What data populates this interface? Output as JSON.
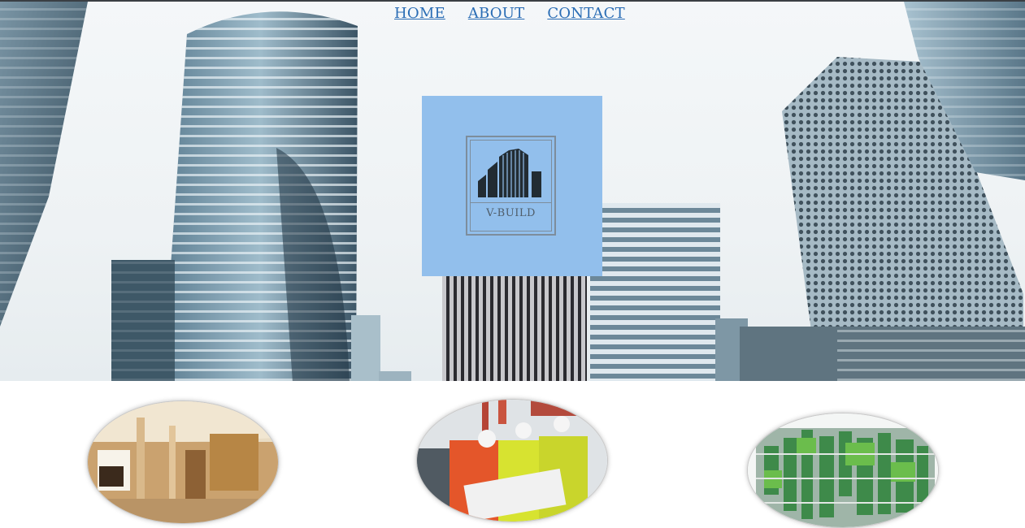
{
  "nav": {
    "links": [
      {
        "label": "HOME"
      },
      {
        "label": "ABOUT"
      },
      {
        "label": "CONTACT"
      }
    ]
  },
  "hero": {
    "image": "city-skyscrapers-photo"
  },
  "logo": {
    "text": "V-BUILD",
    "icon": "building-icon",
    "background_color": "#92bfec"
  },
  "services": [
    {
      "image": "wooden-interior-photo"
    },
    {
      "image": "construction-workers-photo"
    },
    {
      "image": "green-wall-building-photo"
    }
  ],
  "colors": {
    "link": "#2a6db5",
    "logo_box": "#92bfec"
  }
}
